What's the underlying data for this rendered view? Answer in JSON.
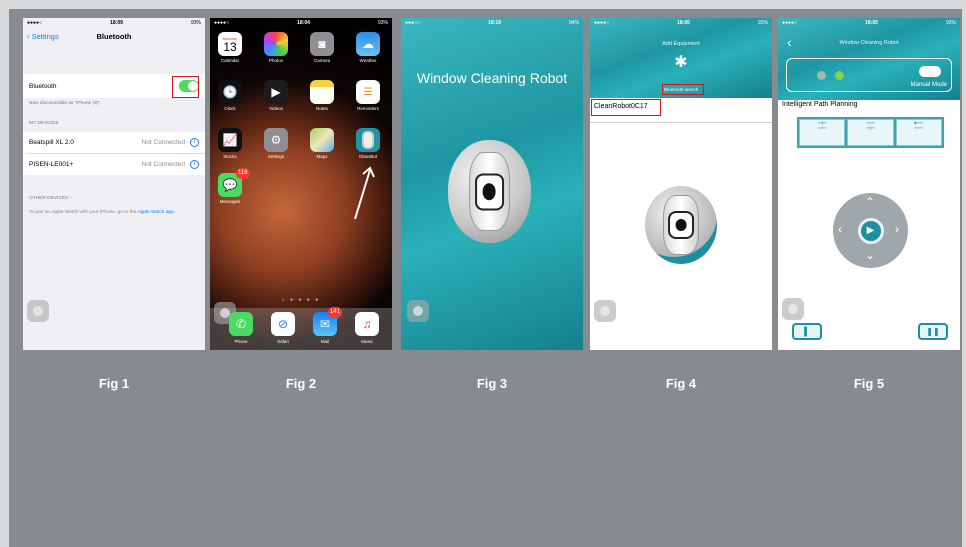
{
  "captions": [
    "Fig 1",
    "Fig 2",
    "Fig 3",
    "Fig 4",
    "Fig 5"
  ],
  "fig1": {
    "status": {
      "carrier": "●●●●○",
      "time": "18:09",
      "battery": "93%"
    },
    "nav": {
      "back": "Settings",
      "title": "Bluetooth"
    },
    "bluetooth_label": "Bluetooth",
    "bluetooth_on": true,
    "discoverable": "Now discoverable as \"iPhone (4)\".",
    "my_devices_header": "MY DEVICES",
    "devices": [
      {
        "name": "Beatspill XL 2.0",
        "status": "Not Connected"
      },
      {
        "name": "PISEN-LE001+",
        "status": "Not Connected"
      }
    ],
    "other_devices_header": "OTHER DEVICES",
    "pair_text": "To pair an Apple Watch with your iPhone, go to the",
    "pair_link": "Apple Watch app."
  },
  "fig2": {
    "status": {
      "carrier": "●●●●○",
      "time": "18:04",
      "battery": "93%"
    },
    "calendar": {
      "day": "Monday",
      "date": "13"
    },
    "apps": [
      "Calendar",
      "Photos",
      "Camera",
      "Weather",
      "Clock",
      "Videos",
      "Notes",
      "Reminders",
      "Stocks",
      "Settings",
      "Maps",
      "GlassBot",
      "Messages"
    ],
    "messages_badge": "118",
    "dock": [
      "Phone",
      "Safari",
      "Mail",
      "Music"
    ],
    "mail_badge": "141"
  },
  "fig3": {
    "status": {
      "carrier": "●●●○○",
      "time": "18:19",
      "battery": "94%"
    },
    "title": "Window Cleaning Robot"
  },
  "fig4": {
    "status": {
      "carrier": "●●●●○",
      "time": "18:05",
      "battery": "93%"
    },
    "title": "Add Equipment",
    "search_label": "Bluetooth search",
    "device": "CleanRobot0C17"
  },
  "fig5": {
    "status": {
      "carrier": "●●●●○",
      "time": "18:05",
      "battery": "93%"
    },
    "title": "Window Cleaning Robot",
    "mode_label": "Manual Mode",
    "path_planning": "Intelligent Path Planning",
    "indicator_colors": [
      "#9fb8a8",
      "#8bd04a"
    ]
  }
}
